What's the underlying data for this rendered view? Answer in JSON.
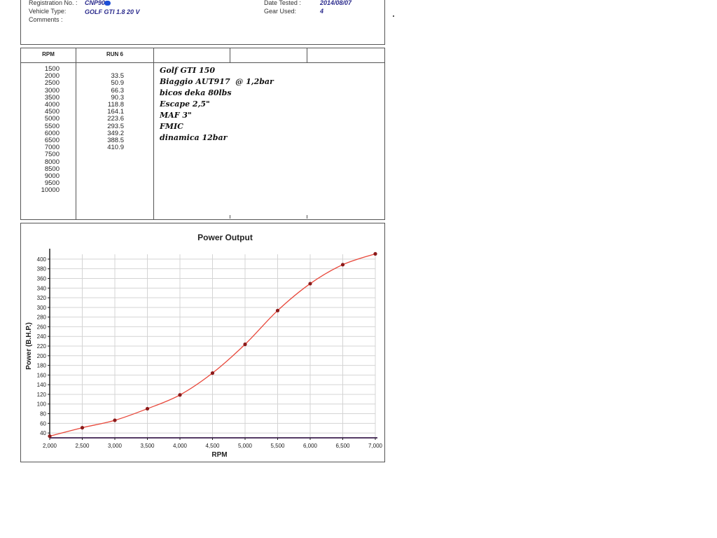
{
  "header": {
    "registration_label": "Registration No. :",
    "registration_value": "CNP90",
    "vehicle_label": "Vehicle Type:",
    "vehicle_value": "GOLF GTI 1.8 20 V",
    "comments_label": "Comments :",
    "date_label": "Date Tested :",
    "date_value": "2014/08/07",
    "gear_label": "Gear Used:",
    "gear_value": "4"
  },
  "table": {
    "col_rpm": "RPM",
    "col_run": "RUN 6",
    "rpm": [
      "1500",
      "2000",
      "2500",
      "3000",
      "3500",
      "4000",
      "4500",
      "5000",
      "5500",
      "6000",
      "6500",
      "7000",
      "7500",
      "8000",
      "8500",
      "9000",
      "9500",
      "10000"
    ],
    "run": [
      "",
      "33.5",
      "50.9",
      "66.3",
      "90.3",
      "118.8",
      "164.1",
      "223.6",
      "293.5",
      "349.2",
      "388.5",
      "410.9"
    ],
    "notes": [
      "Golf GTI 150",
      "Biaggio AUT917  @ 1,2bar",
      "bicos deka 80lbs",
      "Escape 2,5\"",
      "MAF 3\"",
      "FMIC",
      "dinamica 12bar"
    ]
  },
  "chart_data": {
    "type": "line",
    "title": "Power Output",
    "xlabel": "RPM",
    "ylabel": "Power (B.H.P.)",
    "x": [
      2000,
      2500,
      3000,
      3500,
      4000,
      4500,
      5000,
      5500,
      6000,
      6500,
      7000
    ],
    "series": [
      {
        "values": [
          33.5,
          50.9,
          66.3,
          90.3,
          118.8,
          164.1,
          223.6,
          293.5,
          349.2,
          388.5,
          410.9
        ]
      }
    ],
    "xlim": [
      2000,
      7000
    ],
    "ylim": [
      30,
      410
    ],
    "x_ticks": [
      "2,000",
      "2,500",
      "3,000",
      "3,500",
      "4,000",
      "4,500",
      "5,000",
      "5,500",
      "6,000",
      "6,500",
      "7,000"
    ],
    "y_ticks": [
      "40",
      "60",
      "80",
      "100",
      "120",
      "140",
      "160",
      "180",
      "200",
      "220",
      "240",
      "260",
      "280",
      "300",
      "320",
      "340",
      "360",
      "380",
      "400"
    ],
    "grid": true,
    "line_color": "#e8473a",
    "point_color": "#8b1a1a"
  }
}
